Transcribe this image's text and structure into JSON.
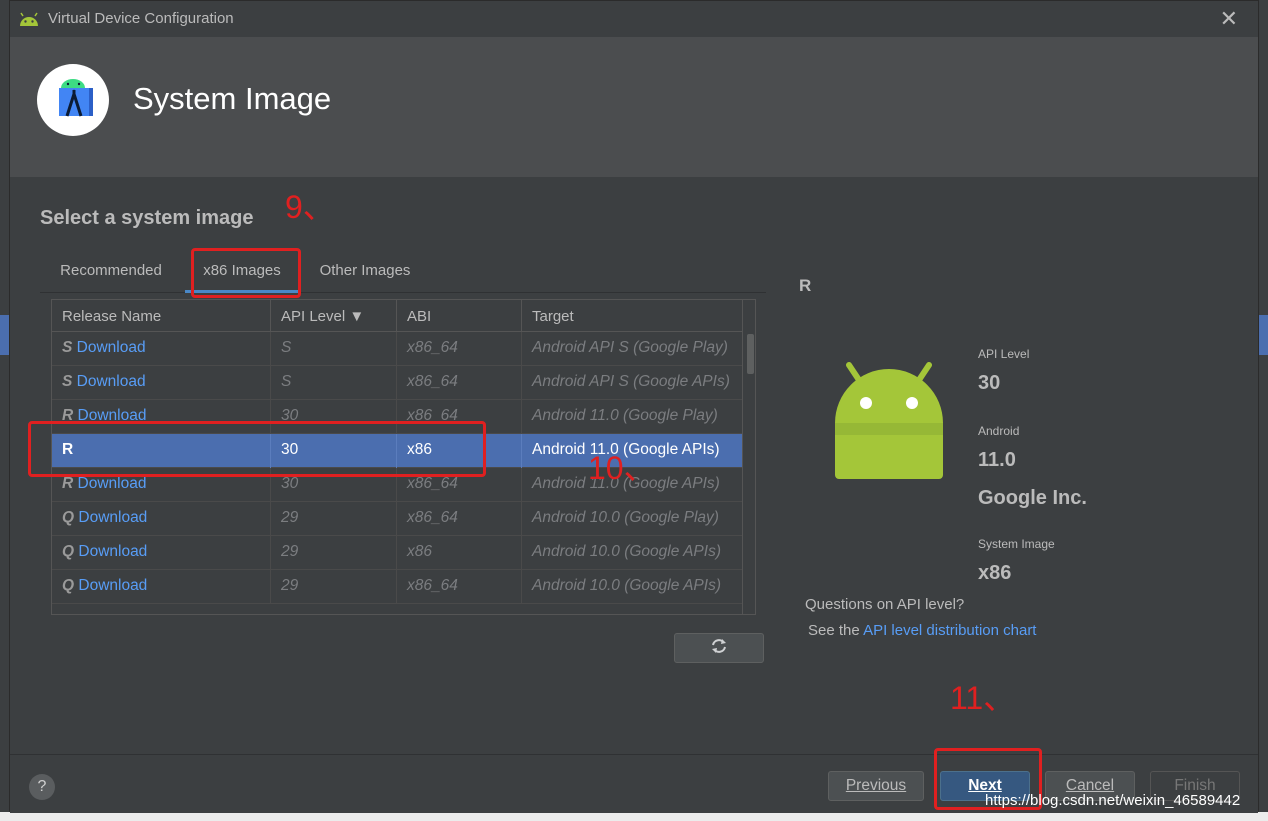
{
  "window": {
    "title": "Virtual Device Configuration",
    "close_glyph": "✕"
  },
  "header": {
    "heading": "System Image"
  },
  "section_title": "Select a system image",
  "tabs": [
    {
      "label": "Recommended",
      "active": false
    },
    {
      "label": "x86 Images",
      "active": true
    },
    {
      "label": "Other Images",
      "active": false
    }
  ],
  "table": {
    "columns": [
      "Release Name",
      "API Level ▼",
      "ABI",
      "Target"
    ],
    "rows": [
      {
        "letter": "S",
        "release": "Download",
        "api": "S",
        "abi": "x86_64",
        "target": "Android API S (Google Play)",
        "selected": false
      },
      {
        "letter": "S",
        "release": "Download",
        "api": "S",
        "abi": "x86_64",
        "target": "Android API S (Google APIs)",
        "selected": false
      },
      {
        "letter": "R",
        "release": "Download",
        "api": "30",
        "abi": "x86_64",
        "target": "Android 11.0 (Google Play)",
        "selected": false
      },
      {
        "letter": "R",
        "release": "",
        "api": "30",
        "abi": "x86",
        "target": "Android 11.0 (Google APIs)",
        "selected": true
      },
      {
        "letter": "R",
        "release": "Download",
        "api": "30",
        "abi": "x86_64",
        "target": "Android 11.0 (Google APIs)",
        "selected": false
      },
      {
        "letter": "Q",
        "release": "Download",
        "api": "29",
        "abi": "x86_64",
        "target": "Android 10.0 (Google Play)",
        "selected": false
      },
      {
        "letter": "Q",
        "release": "Download",
        "api": "29",
        "abi": "x86",
        "target": "Android 10.0 (Google APIs)",
        "selected": false
      },
      {
        "letter": "Q",
        "release": "Download",
        "api": "29",
        "abi": "x86_64",
        "target": "Android 10.0 (Google APIs)",
        "selected": false
      }
    ]
  },
  "details": {
    "title": "R",
    "api_level_label": "API Level",
    "api_level_value": "30",
    "android_label": "Android",
    "android_value": "11.0",
    "vendor": "Google Inc.",
    "system_image_label": "System Image",
    "system_image_value": "x86",
    "question": "Questions on API level?",
    "see_the": "See the ",
    "link": "API level distribution chart"
  },
  "footer": {
    "help": "?",
    "previous": "Previous",
    "next": "Next",
    "cancel": "Cancel",
    "finish": "Finish"
  },
  "annotations": {
    "step9": "9、",
    "step10": "10、",
    "step11": "11、"
  },
  "watermark": "https://blog.csdn.net/weixin_46589442",
  "colors": {
    "accent": "#4b6eaf",
    "link": "#589df6",
    "annotation": "#e02020",
    "android_green": "#a4c639"
  }
}
